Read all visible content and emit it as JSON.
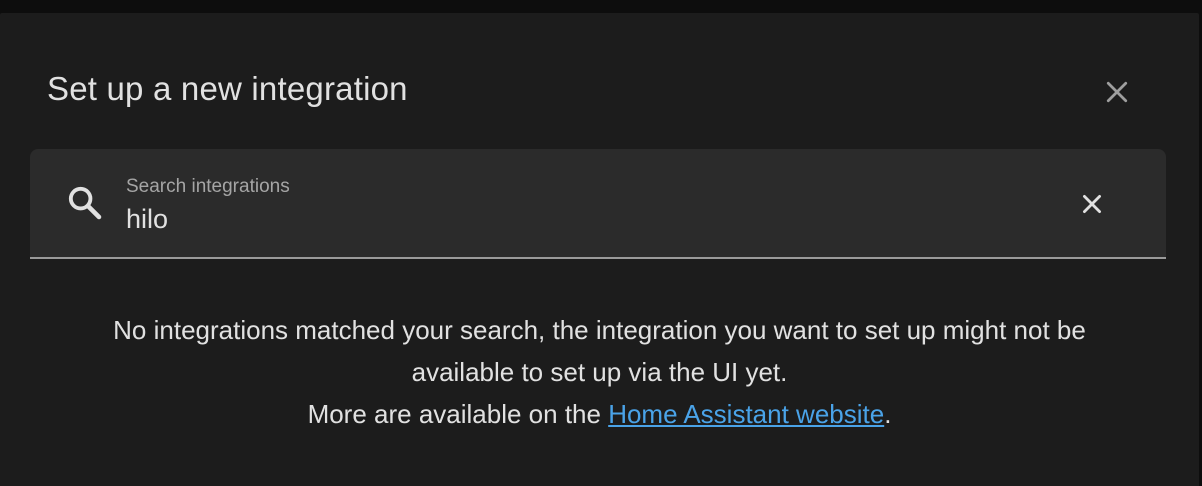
{
  "dialog": {
    "title": "Set up a new integration",
    "close_icon": "close-icon"
  },
  "search": {
    "icon": "search-icon",
    "label": "Search integrations",
    "value": "hilo",
    "clear_icon": "clear-icon"
  },
  "message": {
    "line1": "No integrations matched your search, the integration you want to set up might not be",
    "line2": "available to set up via the UI yet.",
    "line3_prefix": "More are available on the ",
    "link_text": "Home Assistant website",
    "line3_suffix": "."
  },
  "colors": {
    "background": "#1c1c1c",
    "field": "#2b2b2b",
    "text": "#e1e1e1",
    "muted": "#a5a5a5",
    "link": "#4aa3e8"
  }
}
